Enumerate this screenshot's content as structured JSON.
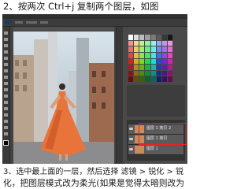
{
  "caption_top": "2、按两次 Ctrl+j 复制两个图层，如图",
  "caption_bottom_1": "3、选中最上面的一层，然后选择 滤镜 > 锐化 > 锐",
  "caption_bottom_2": "化，把图层模式改为柔光(如果是觉得太暗则改为",
  "colors": {
    "highlight": "#e32626",
    "ui_dark": "#434343",
    "dress": "#e8743c"
  },
  "layers_panel": {
    "items": [
      "图层 1 拷贝 2",
      "图层 1 拷贝",
      "图层 1"
    ]
  }
}
